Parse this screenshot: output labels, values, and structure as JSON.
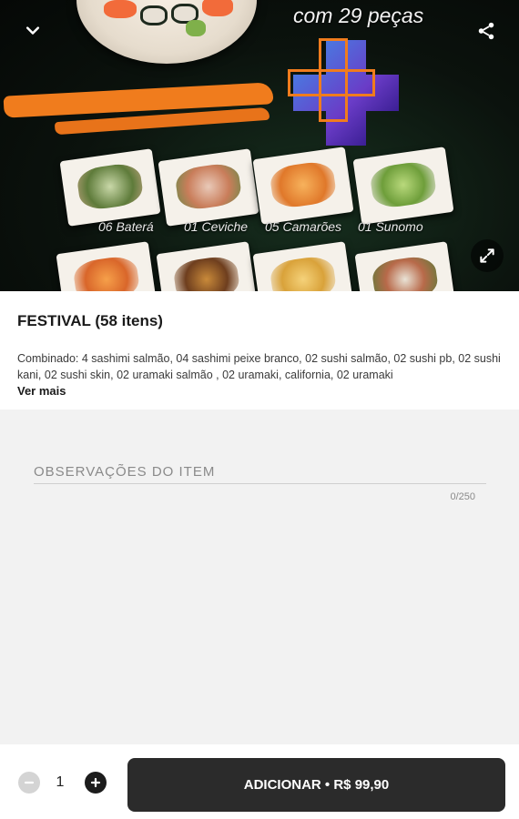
{
  "hero": {
    "promo_line": "com 29 peças",
    "dish_labels": [
      "06 Baterá",
      "01 Ceviche",
      "05 Camarões",
      "01 Sunomo"
    ],
    "icons": {
      "back": "chevron-down-icon",
      "share": "share-icon",
      "expand": "expand-icon"
    }
  },
  "item": {
    "title": "FESTIVAL (58 itens)",
    "description": "Combinado: 4 sashimi salmão, 04 sashimi peixe branco, 02 sushi salmão, 02 sushi pb, 02 sushi kani, 02 sushi skin, 02 uramaki salmão , 02 uramaki, california, 02 uramaki",
    "see_more": "Ver mais"
  },
  "observations": {
    "placeholder": "OBSERVAÇÕES DO ITEM",
    "value": "",
    "counter": "0/250"
  },
  "footer": {
    "quantity": "1",
    "add_label": "ADICIONAR • R$ 99,90"
  },
  "colors": {
    "accent_orange": "#f07c1d",
    "plus_blue": "#4a78e0",
    "button_dark": "#2b2b2b",
    "background": "#f2f2f2"
  }
}
